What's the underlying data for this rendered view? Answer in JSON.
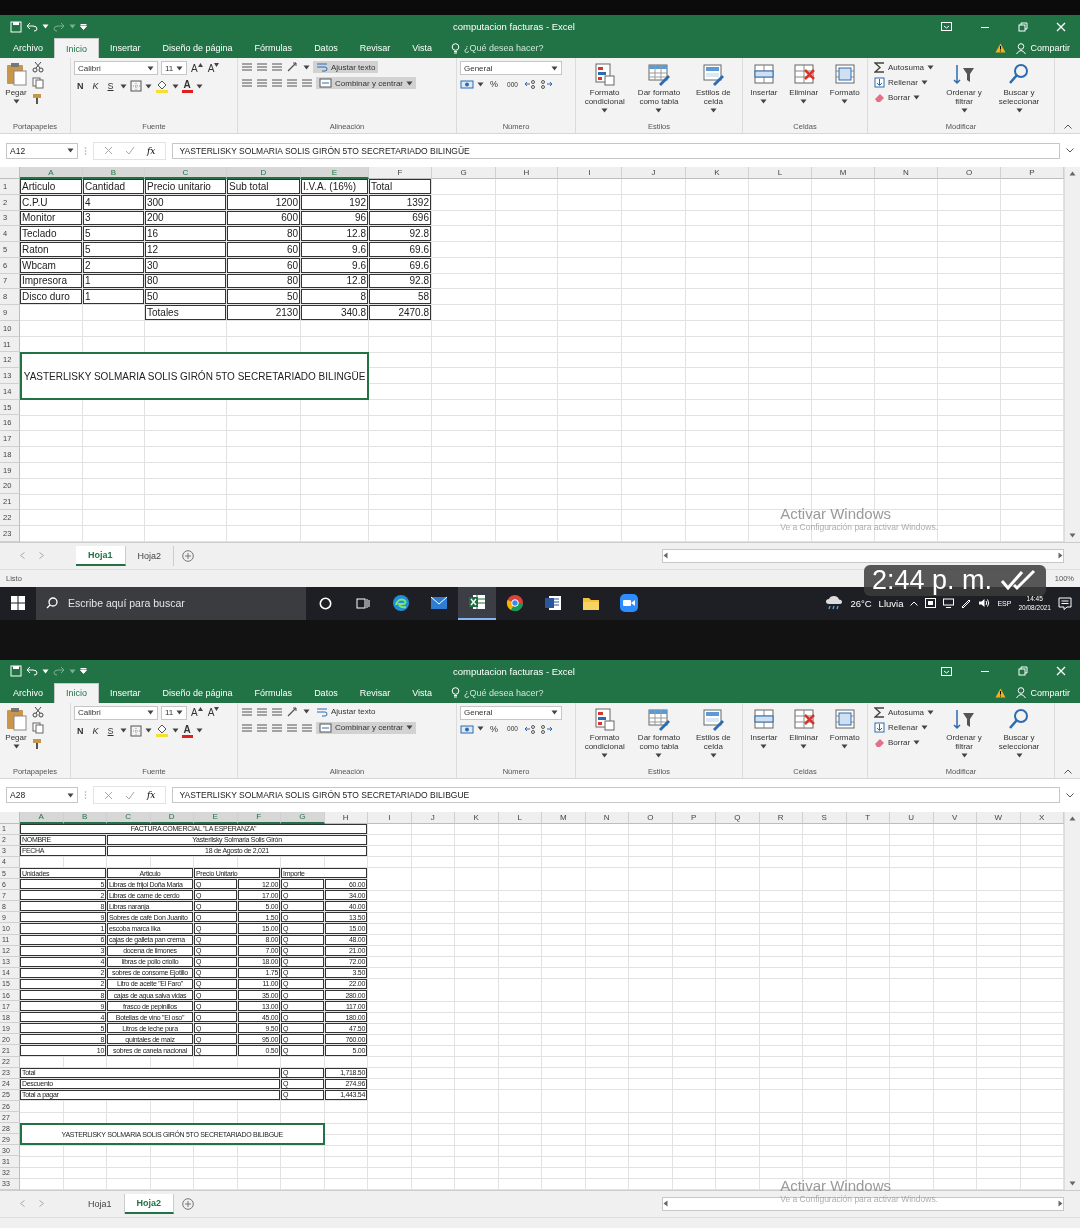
{
  "screens": [
    {
      "title_bar": {
        "title": "computacion facturas - Excel"
      },
      "ribbon_tabs": [
        {
          "label": "Archivo",
          "selected": false
        },
        {
          "label": "Inicio",
          "selected": true
        },
        {
          "label": "Insertar",
          "selected": false
        },
        {
          "label": "Diseño de página",
          "selected": false
        },
        {
          "label": "Fórmulas",
          "selected": false
        },
        {
          "label": "Datos",
          "selected": false
        },
        {
          "label": "Revisar",
          "selected": false
        },
        {
          "label": "Vista",
          "selected": false
        }
      ],
      "tell_me": {
        "placeholder": "¿Qué desea hacer?"
      },
      "share": "Compartir",
      "ribbon": {
        "clipboard": {
          "label": "Portapapeles",
          "paste": "Pegar"
        },
        "font": {
          "label": "Fuente",
          "family": "Calibri",
          "size": "11",
          "grow": "A",
          "shrink": "A",
          "bold": "N",
          "italic": "K",
          "underline": "S",
          "color_letter": "A"
        },
        "alignment": {
          "label": "Alineación",
          "wrap": {
            "label": "Ajustar texto",
            "pressed": true
          },
          "merge": {
            "label": "Combinar y centrar",
            "pressed": true
          }
        },
        "number": {
          "label": "Número",
          "format": "General",
          "percent": "%",
          "thousands": "000"
        },
        "styles": {
          "label": "Estilos",
          "buttons": [
            "Formato condicional",
            "Dar formato como tabla",
            "Estilos de celda"
          ]
        },
        "cells": {
          "label": "Celdas",
          "buttons": [
            "Insertar",
            "Eliminar",
            "Formato"
          ]
        },
        "editing": {
          "label": "Modificar",
          "autosum": "Autosuma",
          "fill": "Rellenar",
          "clear": "Borrar",
          "sort": "Ordenar y filtrar",
          "find": "Buscar y seleccionar"
        }
      },
      "formula_bar": {
        "name_box": "A12",
        "function_label": "fx",
        "value": "YASTERLISKY SOLMARIA SOLIS GIRÓN 5TO SECRETARIADO BILINGÜE"
      },
      "sheet": {
        "kind": "table",
        "column_headers": [
          "A",
          "B",
          "C",
          "D",
          "E",
          "F",
          "G",
          "H",
          "I",
          "J",
          "K",
          "L",
          "M",
          "N",
          "O",
          "P"
        ],
        "row_headers": [
          "1",
          "2",
          "3",
          "4",
          "5",
          "6",
          "7",
          "8",
          "9",
          "10",
          "11",
          "12",
          "13",
          "14",
          "15",
          "16",
          "17",
          "18",
          "19",
          "20",
          "21",
          "22",
          "23"
        ],
        "header": [
          "Articulo",
          "Cantidad",
          "Precio unitario",
          "Sub total",
          "I.V.A. (16%)",
          "Total"
        ],
        "rows": [
          [
            "C.P.U",
            "4",
            "300",
            "1200",
            "192",
            "1392"
          ],
          [
            "Monitor",
            "3",
            "200",
            "600",
            "96",
            "696"
          ],
          [
            "Teclado",
            "5",
            "16",
            "80",
            "12.8",
            "92.8"
          ],
          [
            "Raton",
            "5",
            "12",
            "60",
            "9.6",
            "69.6"
          ],
          [
            "Wbcam",
            "2",
            "30",
            "60",
            "9.6",
            "69.6"
          ],
          [
            "Impresora",
            "1",
            "80",
            "80",
            "12.8",
            "92.8"
          ],
          [
            "Disco duro",
            "1",
            "50",
            "50",
            "8",
            "58"
          ]
        ],
        "totals": [
          {
            "label": "Totales",
            "values": [
              "2130",
              "340.8",
              "2470.8"
            ]
          }
        ],
        "note": "YASTERLISKY SOLMARIA SOLIS GIRÓN 5TO SECRETARIADO BILINGÜE"
      },
      "activation": {
        "title": "Activar Windows",
        "subtitle": "Ve a Configuración para activar Windows."
      },
      "sheet_tabs": [
        {
          "label": "Hoja1",
          "selected": true
        },
        {
          "label": "Hoja2",
          "selected": false
        }
      ],
      "status_bar": {
        "status": "Listo",
        "zoom": "100%"
      },
      "taskbar": {
        "search": {
          "placeholder": "Escribe aquí para buscar"
        },
        "temperature": "26°C",
        "condition": "Lluvia",
        "language": "ESP",
        "time": "14:45",
        "date": "20/08/2021"
      },
      "message_overlay": {
        "time": "2:44 p. m."
      }
    },
    {
      "title_bar": {
        "title": "computacion facturas - Excel"
      },
      "ribbon_tabs": [
        {
          "label": "Archivo",
          "selected": false
        },
        {
          "label": "Inicio",
          "selected": true
        },
        {
          "label": "Insertar",
          "selected": false
        },
        {
          "label": "Diseño de página",
          "selected": false
        },
        {
          "label": "Fórmulas",
          "selected": false
        },
        {
          "label": "Datos",
          "selected": false
        },
        {
          "label": "Revisar",
          "selected": false
        },
        {
          "label": "Vista",
          "selected": false
        }
      ],
      "tell_me": {
        "placeholder": "¿Qué desea hacer?"
      },
      "share": "Compartir",
      "ribbon": {
        "clipboard": {
          "label": "Portapapeles",
          "paste": "Pegar"
        },
        "font": {
          "label": "Fuente",
          "family": "Calibri",
          "size": "11",
          "grow": "A",
          "shrink": "A",
          "bold": "N",
          "italic": "K",
          "underline": "S",
          "color_letter": "A"
        },
        "alignment": {
          "label": "Alineación",
          "wrap": {
            "label": "Ajustar texto",
            "pressed": false
          },
          "merge": {
            "label": "Combinar y centrar",
            "pressed": true
          }
        },
        "number": {
          "label": "Número",
          "format": "General",
          "percent": "%",
          "thousands": "000"
        },
        "styles": {
          "label": "Estilos",
          "buttons": [
            "Formato condicional",
            "Dar formato como tabla",
            "Estilos de celda"
          ]
        },
        "cells": {
          "label": "Celdas",
          "buttons": [
            "Insertar",
            "Eliminar",
            "Formato"
          ]
        },
        "editing": {
          "label": "Modificar",
          "autosum": "Autosuma",
          "fill": "Rellenar",
          "clear": "Borrar",
          "sort": "Ordenar y filtrar",
          "find": "Buscar y seleccionar"
        }
      },
      "formula_bar": {
        "name_box": "A28",
        "function_label": "fx",
        "value": "YASTERLISKY SOLMARIA SOLIS GIRÓN 5TO SECRETARIADO BILIBGUE"
      },
      "sheet": {
        "kind": "invoice",
        "column_headers": [
          "A",
          "B",
          "C",
          "D",
          "E",
          "F",
          "G",
          "H",
          "I",
          "J",
          "K",
          "L",
          "M",
          "N",
          "O",
          "P",
          "Q",
          "R",
          "S",
          "T",
          "U",
          "V",
          "W",
          "X"
        ],
        "row_headers": [
          "1",
          "2",
          "3",
          "4",
          "5",
          "6",
          "7",
          "8",
          "9",
          "10",
          "11",
          "12",
          "13",
          "14",
          "15",
          "16",
          "17",
          "18",
          "19",
          "20",
          "21",
          "22",
          "23",
          "24",
          "25",
          "26",
          "27",
          "28",
          "29",
          "30",
          "31",
          "32",
          "33"
        ],
        "title": "FACTURA COMERCIAL \"LA ESPERANZA\"",
        "fields": [
          {
            "label": "NOMBRE",
            "value": "Yasterlisky Solmaria Solis Girón"
          },
          {
            "label": "FECHA",
            "value": "18 de Agosto de 2,021"
          }
        ],
        "header": [
          "Unidades",
          "Articulo",
          "Precio Unitario",
          "Importe"
        ],
        "items": [
          {
            "units": "5",
            "article": "Libras de frijol Doña Maria",
            "currency": "Q",
            "price": "12.00",
            "currency_2": "Q",
            "amount": "60.00"
          },
          {
            "units": "2",
            "article": "Libras de carne de cerdo",
            "currency": "Q",
            "price": "17.00",
            "currency_2": "Q",
            "amount": "34.00"
          },
          {
            "units": "8",
            "article": "Libras naranja",
            "currency": "Q",
            "price": "5.00",
            "currency_2": "Q",
            "amount": "40.00"
          },
          {
            "units": "9",
            "article": "Sobres de café Don Juanito",
            "currency": "Q",
            "price": "1.50",
            "currency_2": "Q",
            "amount": "13.50"
          },
          {
            "units": "1",
            "article": "escoba marca lika",
            "currency": "Q",
            "price": "15.00",
            "currency_2": "Q",
            "amount": "15.00"
          },
          {
            "units": "6",
            "article": "cajas de galleta pan crema",
            "currency": "Q",
            "price": "8.00",
            "currency_2": "Q",
            "amount": "48.00"
          },
          {
            "units": "3",
            "article": "docena de limones",
            "currency": "Q",
            "price": "7.00",
            "currency_2": "Q",
            "amount": "21.00"
          },
          {
            "units": "4",
            "article": "libras de pollo criollo",
            "currency": "Q",
            "price": "18.00",
            "currency_2": "Q",
            "amount": "72.00"
          },
          {
            "units": "2",
            "article": "sobres de consome Ejotillo",
            "currency": "Q",
            "price": "1.75",
            "currency_2": "Q",
            "amount": "3.50"
          },
          {
            "units": "2",
            "article": "Litro de aceite \"El Faro\"",
            "currency": "Q",
            "price": "11.00",
            "currency_2": "Q",
            "amount": "22.00"
          },
          {
            "units": "8",
            "article": "cajas de agua salva vidas",
            "currency": "Q",
            "price": "35.00",
            "currency_2": "Q",
            "amount": "280.00"
          },
          {
            "units": "9",
            "article": "frasco de pepinillos",
            "currency": "Q",
            "price": "13.00",
            "currency_2": "Q",
            "amount": "117.00"
          },
          {
            "units": "4",
            "article": "Botellas de vino \"El oso\"",
            "currency": "Q",
            "price": "45.00",
            "currency_2": "Q",
            "amount": "180.00"
          },
          {
            "units": "5",
            "article": "Litros de leche pura",
            "currency": "Q",
            "price": "9.50",
            "currency_2": "Q",
            "amount": "47.50"
          },
          {
            "units": "8",
            "article": "quintales de maiz",
            "currency": "Q",
            "price": "95.00",
            "currency_2": "Q",
            "amount": "760.00"
          },
          {
            "units": "10",
            "article": "sobres de canela nacional",
            "currency": "Q",
            "price": "0.50",
            "currency_2": "Q",
            "amount": "5.00"
          }
        ],
        "totals": [
          {
            "label": "Total",
            "currency": "Q",
            "values": [
              "1,718.50"
            ]
          },
          {
            "label": "Descuento",
            "currency": "Q",
            "values": [
              "274.96"
            ]
          },
          {
            "label": "Total a pagar",
            "currency": "Q",
            "values": [
              "1,443.54"
            ]
          }
        ],
        "note": "YASTERLISKY SOLMARIA SOLIS GIRÓN 5TO SECRETARIADO BILIBGUE"
      },
      "activation": {
        "title": "Activar Windows",
        "subtitle": "Ve a Configuración para activar Windows."
      },
      "sheet_tabs": [
        {
          "label": "Hoja1",
          "selected": false
        },
        {
          "label": "Hoja2",
          "selected": true
        }
      ]
    }
  ]
}
